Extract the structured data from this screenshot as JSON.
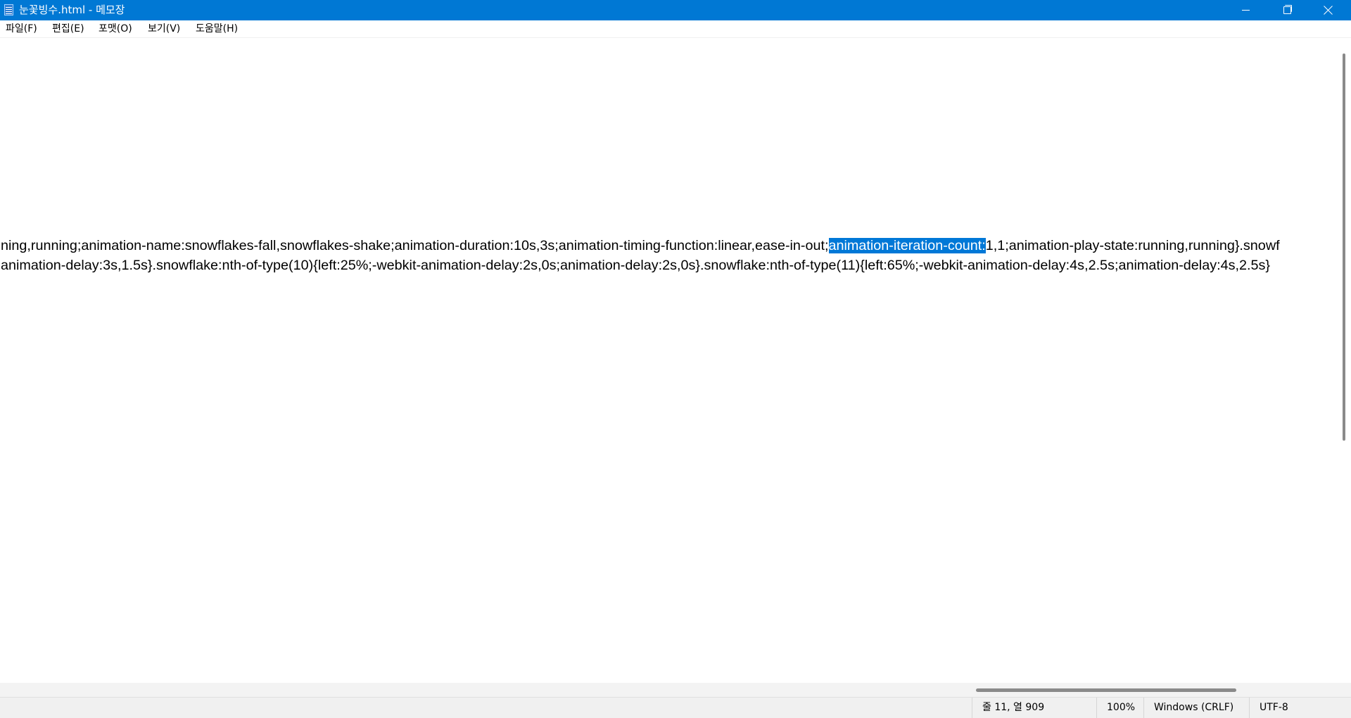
{
  "window": {
    "title": "눈꽃빙수.html - 메모장",
    "controls": {
      "minimize": "minimize",
      "restore": "restore",
      "close": "close"
    }
  },
  "menu": {
    "items": [
      {
        "label": "파일(F)"
      },
      {
        "label": "편집(E)"
      },
      {
        "label": "포맷(O)"
      },
      {
        "label": "보기(V)"
      },
      {
        "label": "도움말(H)"
      }
    ]
  },
  "editor": {
    "line1_before": "ning,running;animation-name:snowflakes-fall,snowflakes-shake;animation-duration:10s,3s;animation-timing-function:linear,ease-in-out;",
    "line1_selected": "animation-iteration-count:",
    "line1_after": "1,1;animation-play-state:running,running}.snowf",
    "line2": "animation-delay:3s,1.5s}.snowflake:nth-of-type(10){left:25%;-webkit-animation-delay:2s,0s;animation-delay:2s,0s}.snowflake:nth-of-type(11){left:65%;-webkit-animation-delay:4s,2.5s;animation-delay:4s,2.5s}"
  },
  "status": {
    "position": "줄 11, 열 909",
    "zoom": "100%",
    "line_ending": "Windows (CRLF)",
    "encoding": "UTF-8"
  },
  "colors": {
    "titlebar": "#0078d4",
    "selection": "#0078d7",
    "statusbar": "#f0f0f0"
  }
}
